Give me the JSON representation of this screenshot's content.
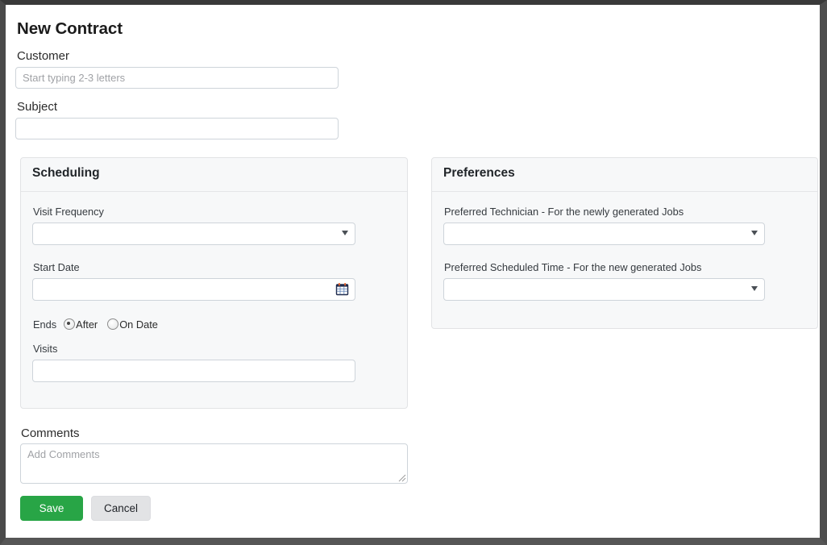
{
  "page": {
    "title": "New Contract"
  },
  "customer": {
    "label": "Customer",
    "placeholder": "Start typing 2-3 letters",
    "value": ""
  },
  "subject": {
    "label": "Subject",
    "placeholder": "",
    "value": ""
  },
  "scheduling": {
    "title": "Scheduling",
    "visit_frequency": {
      "label": "Visit Frequency",
      "value": ""
    },
    "start_date": {
      "label": "Start Date",
      "value": "",
      "icon": "calendar-icon"
    },
    "ends": {
      "label": "Ends",
      "options": [
        {
          "label": "After",
          "selected": true
        },
        {
          "label": "On Date",
          "selected": false
        }
      ]
    },
    "visits": {
      "label": "Visits",
      "value": ""
    }
  },
  "preferences": {
    "title": "Preferences",
    "preferred_technician": {
      "label": "Preferred Technician - For the newly generated Jobs",
      "value": ""
    },
    "preferred_scheduled_time": {
      "label": "Preferred Scheduled Time - For the new generated Jobs",
      "value": ""
    }
  },
  "comments": {
    "label": "Comments",
    "placeholder": "Add Comments",
    "value": ""
  },
  "actions": {
    "save_label": "Save",
    "cancel_label": "Cancel"
  },
  "colors": {
    "save_green": "#28a546",
    "cancel_gray": "#e2e3e5",
    "panel_bg": "#f7f8f9",
    "border": "#ced4da",
    "page_bg": "#ffffff",
    "frame": "#3d3d3d"
  }
}
